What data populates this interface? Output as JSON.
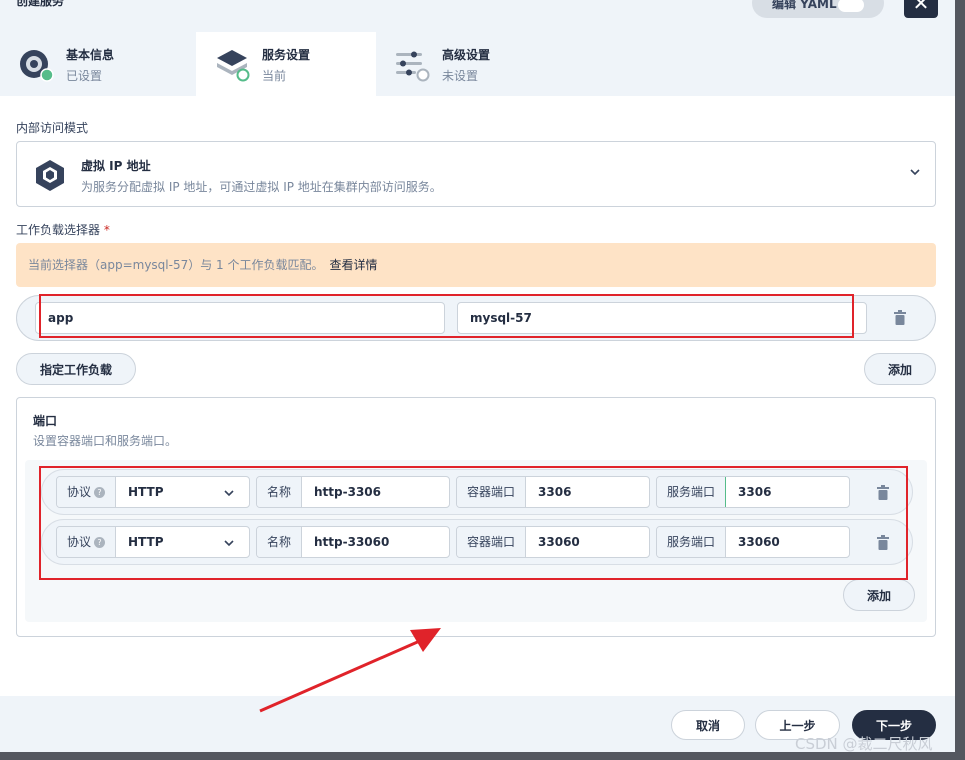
{
  "dialog": {
    "title": "创建服务",
    "yaml_toggle_label": "编辑 YAML",
    "close_glyph": "✕"
  },
  "steps": [
    {
      "title": "基本信息",
      "status": "已设置",
      "icon": "basic-info-icon"
    },
    {
      "title": "服务设置",
      "status": "当前",
      "icon": "service-settings-icon"
    },
    {
      "title": "高级设置",
      "status": "未设置",
      "icon": "advanced-settings-icon"
    }
  ],
  "access_mode": {
    "label": "内部访问模式",
    "title": "虚拟 IP 地址",
    "description": "为服务分配虚拟 IP 地址，可通过虚拟 IP 地址在集群内部访问服务。",
    "icon": "cube-icon"
  },
  "selector": {
    "label": "工作负载选择器",
    "required_mark": "*",
    "alert_text": "当前选择器（app=mysql-57）与 1 个工作负载匹配。",
    "alert_link": "查看详情",
    "key": "app",
    "value": "mysql-57",
    "specify_button": "指定工作负载",
    "add_button": "添加"
  },
  "ports": {
    "title": "端口",
    "description": "设置容器端口和服务端口。",
    "protocol_label": "协议",
    "help_glyph": "?",
    "name_label": "名称",
    "container_port_label": "容器端口",
    "service_port_label": "服务端口",
    "rows": [
      {
        "protocol": "HTTP",
        "name": "http-3306",
        "container_port": "3306",
        "service_port": "3306"
      },
      {
        "protocol": "HTTP",
        "name": "http-33060",
        "container_port": "33060",
        "service_port": "33060"
      }
    ],
    "add_button": "添加"
  },
  "footer": {
    "cancel": "取消",
    "previous": "上一步",
    "next": "下一步"
  },
  "watermark": "CSDN @裁二尺秋风",
  "colors": {
    "brand_dark": "#242e42",
    "success_green": "#55bc8a",
    "warning_bg": "#fee3c6",
    "annotation_red": "#e0232a"
  }
}
